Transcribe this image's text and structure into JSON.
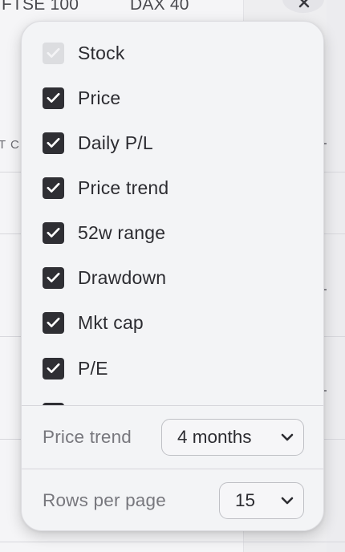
{
  "background": {
    "tabs": [
      "FTSE 100",
      "DAX 40"
    ],
    "column_header_fragment": "T C"
  },
  "popover": {
    "columns": [
      {
        "label": "Stock",
        "checked": true,
        "disabled": true
      },
      {
        "label": "Price",
        "checked": true,
        "disabled": false
      },
      {
        "label": "Daily P/L",
        "checked": true,
        "disabled": false
      },
      {
        "label": "Price trend",
        "checked": true,
        "disabled": false
      },
      {
        "label": "52w range",
        "checked": true,
        "disabled": false
      },
      {
        "label": "Drawdown",
        "checked": true,
        "disabled": false
      },
      {
        "label": "Mkt cap",
        "checked": true,
        "disabled": false
      },
      {
        "label": "P/E",
        "checked": true,
        "disabled": false
      },
      {
        "label": "",
        "checked": true,
        "disabled": false
      }
    ],
    "price_trend": {
      "label": "Price trend",
      "value": "4 months"
    },
    "rows_per_page": {
      "label": "Rows per page",
      "value": "15"
    }
  },
  "colors": {
    "checkbox_checked": "#2f2f34",
    "checkbox_disabled": "#dcdde0",
    "popover_bg": "#f3f4f6"
  }
}
